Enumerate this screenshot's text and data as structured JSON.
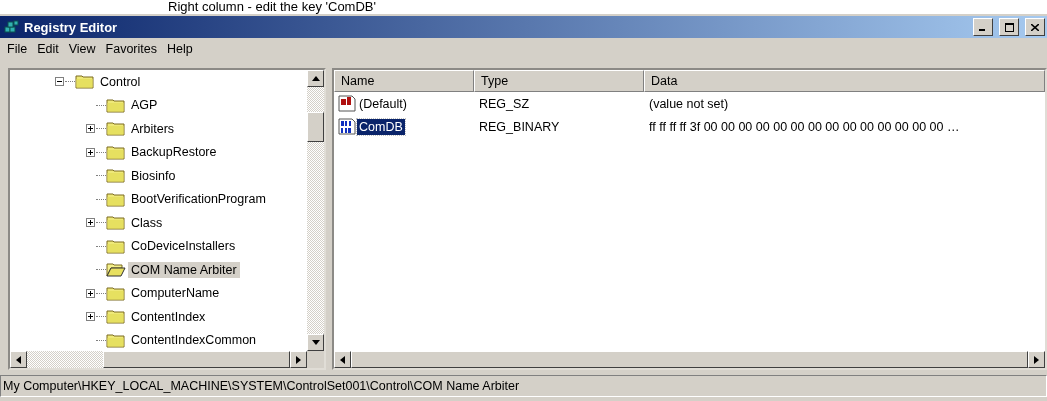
{
  "caption": "Right column - edit the key 'ComDB'",
  "window": {
    "title": "Registry Editor"
  },
  "menu": [
    "File",
    "Edit",
    "View",
    "Favorites",
    "Help"
  ],
  "tree": [
    {
      "label": "Control",
      "expanded": true,
      "selected": false,
      "children": [
        {
          "label": "AGP",
          "expandable": false,
          "selected": false
        },
        {
          "label": "Arbiters",
          "expandable": true,
          "selected": false
        },
        {
          "label": "BackupRestore",
          "expandable": true,
          "selected": false
        },
        {
          "label": "Biosinfo",
          "expandable": false,
          "selected": false
        },
        {
          "label": "BootVerificationProgram",
          "expandable": false,
          "selected": false
        },
        {
          "label": "Class",
          "expandable": true,
          "selected": false
        },
        {
          "label": "CoDeviceInstallers",
          "expandable": false,
          "selected": false
        },
        {
          "label": "COM Name Arbiter",
          "expandable": false,
          "selected": true
        },
        {
          "label": "ComputerName",
          "expandable": true,
          "selected": false
        },
        {
          "label": "ContentIndex",
          "expandable": true,
          "selected": false
        },
        {
          "label": "ContentIndexCommon",
          "expandable": false,
          "selected": false
        }
      ]
    }
  ],
  "list": {
    "columns": [
      "Name",
      "Type",
      "Data"
    ],
    "rows": [
      {
        "kind": "string",
        "name": "(Default)",
        "type": "REG_SZ",
        "data": "(value not set)",
        "selected": false
      },
      {
        "kind": "binary",
        "name": "ComDB",
        "type": "REG_BINARY",
        "data": "ff ff ff ff 3f 00 00 00 00 00 00 00 00 00 00 00 00 00 00 …",
        "selected": true
      }
    ]
  },
  "status_bar": "My Computer\\HKEY_LOCAL_MACHINE\\SYSTEM\\ControlSet001\\Control\\COM Name Arbiter"
}
